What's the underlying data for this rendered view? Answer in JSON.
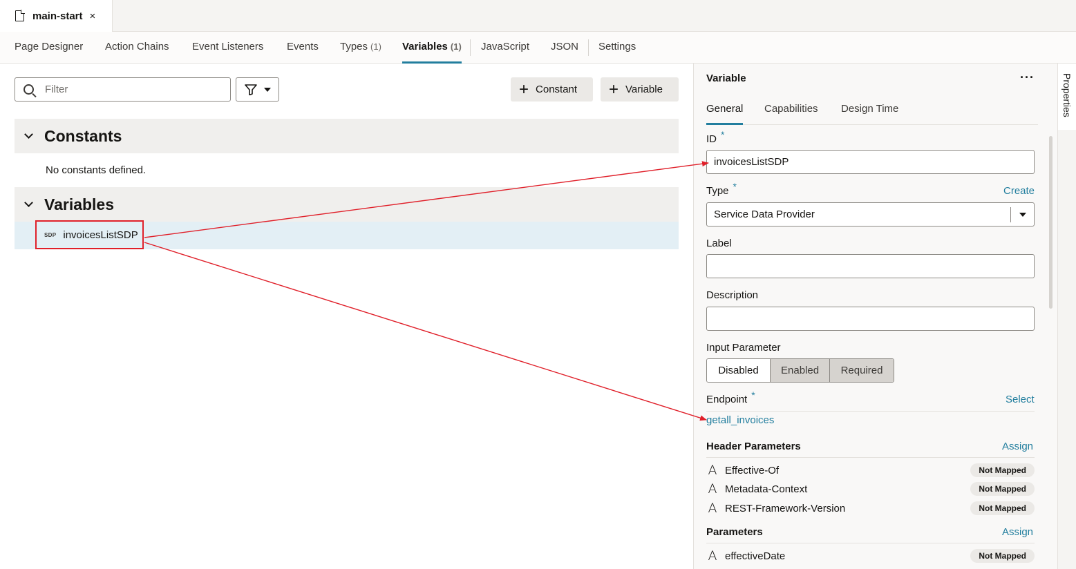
{
  "file_tab": {
    "name": "main-start",
    "close": "×"
  },
  "editor_tabs": [
    {
      "label": "Page Designer",
      "count": ""
    },
    {
      "label": "Action Chains",
      "count": ""
    },
    {
      "label": "Event Listeners",
      "count": ""
    },
    {
      "label": "Events",
      "count": ""
    },
    {
      "label": "Types",
      "count": "(1)"
    },
    {
      "label": "Variables",
      "count": "(1)"
    },
    {
      "label": "JavaScript",
      "count": ""
    },
    {
      "label": "JSON",
      "count": ""
    },
    {
      "label": "Settings",
      "count": ""
    }
  ],
  "toolbar": {
    "filter_placeholder": "Filter",
    "add_constant": "Constant",
    "add_variable": "Variable"
  },
  "constants": {
    "title": "Constants",
    "empty": "No constants defined."
  },
  "variables": {
    "title": "Variables",
    "items": [
      {
        "badge": "SDP",
        "name": "invoicesListSDP"
      }
    ]
  },
  "panel": {
    "title": "Variable",
    "more": "···",
    "tabs": [
      "General",
      "Capabilities",
      "Design Time"
    ],
    "id_label": "ID",
    "id_value": "invoicesListSDP",
    "type_label": "Type",
    "type_link": "Create",
    "type_value": "Service Data Provider",
    "label_label": "Label",
    "label_value": "",
    "description_label": "Description",
    "description_value": "",
    "input_param_label": "Input Parameter",
    "input_param_options": [
      "Disabled",
      "Enabled",
      "Required"
    ],
    "input_param_selected": "Disabled",
    "endpoint_label": "Endpoint",
    "endpoint_link": "Select",
    "endpoint_value": "getall_invoices",
    "header_params_label": "Header Parameters",
    "header_params_link": "Assign",
    "header_params": [
      {
        "name": "Effective-Of",
        "status": "Not Mapped"
      },
      {
        "name": "Metadata-Context",
        "status": "Not Mapped"
      },
      {
        "name": "REST-Framework-Version",
        "status": "Not Mapped"
      }
    ],
    "params_label": "Parameters",
    "params_link": "Assign",
    "params": [
      {
        "name": "effectiveDate",
        "status": "Not Mapped"
      }
    ],
    "required_mark": "*"
  },
  "properties_tab": "Properties",
  "colors": {
    "accent": "#227e9e",
    "annotation": "#e0202a",
    "selected_row": "#e3eff5"
  }
}
